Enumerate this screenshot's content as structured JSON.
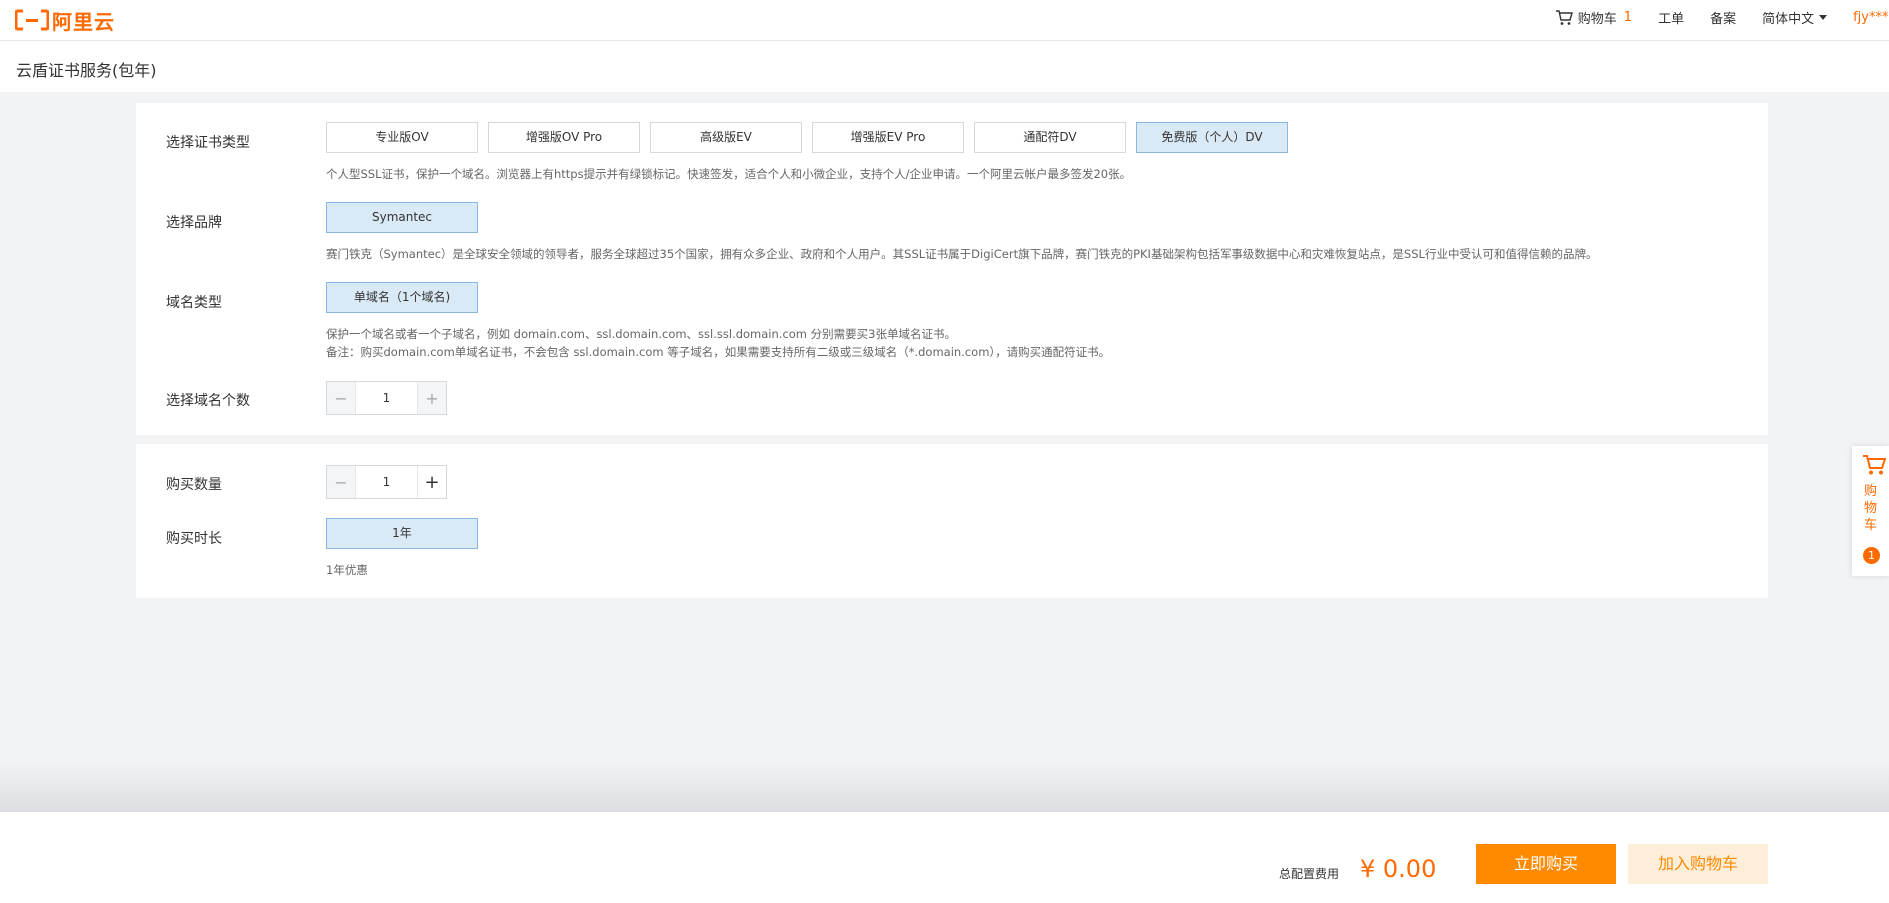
{
  "header": {
    "logo_text": "阿里云",
    "cart_label": "购物车",
    "cart_count": "1",
    "ticket": "工单",
    "beian": "备案",
    "language": "简体中文",
    "user": "fjy****"
  },
  "page": {
    "title": "云盾证书服务(包年)"
  },
  "cert_type": {
    "label": "选择证书类型",
    "options": [
      "专业版OV",
      "增强版OV Pro",
      "高级版EV",
      "增强版EV Pro",
      "通配符DV",
      "免费版（个人）DV"
    ],
    "selected": "免费版（个人）DV",
    "desc": "个人型SSL证书，保护一个域名。浏览器上有https提示并有绿锁标记。快速签发，适合个人和小微企业，支持个人/企业申请。一个阿里云帐户最多签发20张。"
  },
  "brand": {
    "label": "选择品牌",
    "option": "Symantec",
    "desc": "赛门铁克（Symantec）是全球安全领域的领导者，服务全球超过35个国家，拥有众多企业、政府和个人用户。其SSL证书属于DigiCert旗下品牌，赛门铁克的PKI基础架构包括军事级数据中心和灾难恢复站点，是SSL行业中受认可和值得信赖的品牌。"
  },
  "domain_type": {
    "label": "域名类型",
    "option": "单域名（1个域名)",
    "desc1": "保护一个域名或者一个子域名，例如 domain.com、ssl.domain.com、ssl.ssl.domain.com 分别需要买3张单域名证书。",
    "desc2": "备注：购买domain.com单域名证书，不会包含 ssl.domain.com 等子域名，如果需要支持所有二级或三级域名（*.domain.com），请购买通配符证书。"
  },
  "domain_count": {
    "label": "选择域名个数",
    "value": "1"
  },
  "quantity": {
    "label": "购买数量",
    "value": "1"
  },
  "duration": {
    "label": "购买时长",
    "option": "1年",
    "note": "1年优惠"
  },
  "float_cart": {
    "text": "购物车",
    "count": "1"
  },
  "footer": {
    "total_label": "总配置费用",
    "total_price": "¥ 0.00",
    "buy": "立即购买",
    "add_cart": "加入购物车"
  },
  "colors": {
    "accent": "#ff6a00",
    "selected_bg": "#d9eaf6",
    "buy_bg": "#ff8a00"
  }
}
